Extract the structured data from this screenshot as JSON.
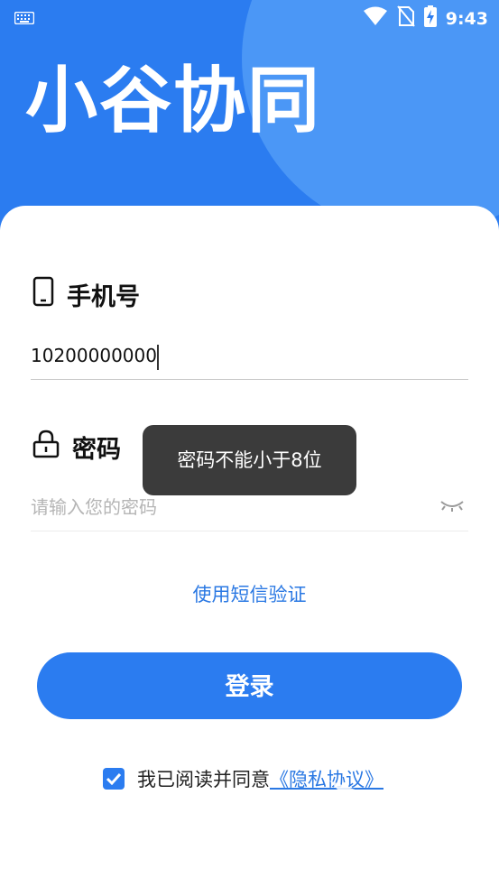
{
  "status_bar": {
    "time": "9:43",
    "icons": [
      "keyboard-icon",
      "wifi-icon",
      "no-sim-icon",
      "battery-charging-icon"
    ]
  },
  "app_title": "小谷协同",
  "phone_field": {
    "label": "手机号",
    "icon": "phone-icon",
    "value": "10200000000",
    "placeholder": ""
  },
  "password_field": {
    "label": "密码",
    "icon": "lock-icon",
    "value": "",
    "placeholder": "请输入您的密码",
    "toggle_icon": "eye-closed-icon"
  },
  "sms_login_link": "使用短信验证",
  "login_button": "登录",
  "agreement": {
    "checked": true,
    "text": "我已阅读并同意",
    "link": "《隐私协议》"
  },
  "toast": "密码不能小于8位",
  "colors": {
    "primary": "#2b7cf0",
    "hero_circle": "#4b97f6",
    "link": "#2a78e3",
    "toast_bg": "#3b3b3b"
  }
}
